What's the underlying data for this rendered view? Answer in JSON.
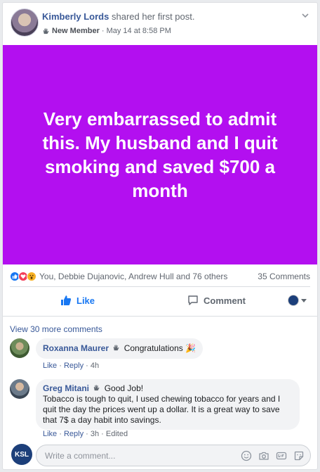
{
  "post": {
    "author": "Kimberly Lords",
    "action": "shared her first post.",
    "badge": "New Member",
    "time": "· May 14 at 8:58 PM",
    "banner_text": "Very embarrassed to admit this. My husband and I quit smoking and saved $700 a month",
    "banner_color": "#b30ff0"
  },
  "reactions": {
    "text": "You, Debbie Dujanovic, Andrew Hull and 76 others",
    "comments_count": "35 Comments"
  },
  "actions": {
    "like": "Like",
    "comment": "Comment"
  },
  "comments": {
    "view_more": "View 30 more comments",
    "items": [
      {
        "name": "Roxanna Maurer",
        "text": "Congratulations 🎉",
        "like": "Like",
        "reply": "Reply",
        "time": "4h",
        "edited": ""
      },
      {
        "name": "Greg Mitani",
        "text_first": "Good Job!",
        "text_body": "Tobacco is tough to quit, I used chewing tobacco for years and I quit the day the prices went up a dollar. It is a great way to save that 7$ a day habit into savings.",
        "like": "Like",
        "reply": "Reply",
        "time": "3h",
        "edited": "Edited"
      }
    ]
  },
  "composer": {
    "avatar_text": "KSL",
    "placeholder": "Write a comment..."
  },
  "colors": {
    "link": "#385898",
    "accent": "#1877f2"
  }
}
